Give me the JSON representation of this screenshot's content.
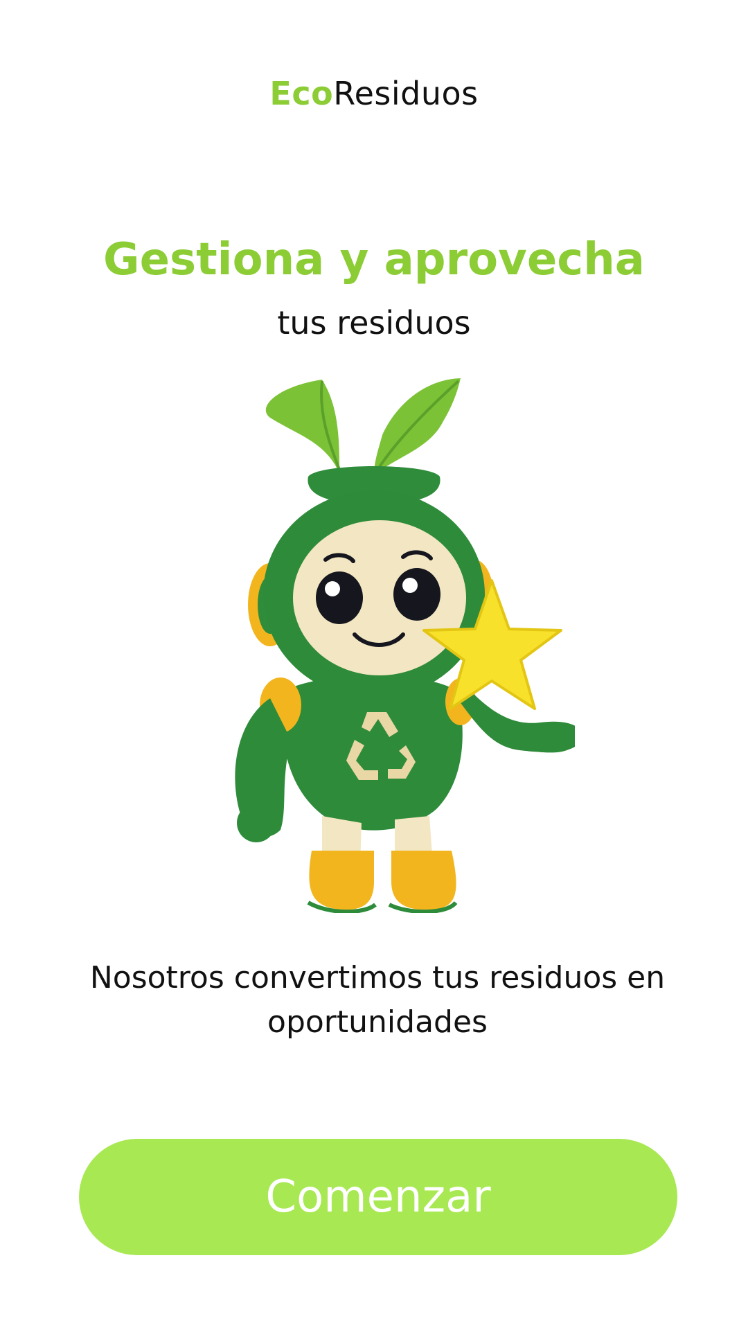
{
  "header": {
    "brand_prefix": "Eco",
    "brand_suffix": "Residuos"
  },
  "hero": {
    "title": "Gestiona y aprovecha",
    "subtitle": "tus residuos",
    "mascot_icon": "recycling-mascot-icon"
  },
  "tagline": "Nosotros convertimos tus residuos en oportunidades",
  "cta": {
    "label": "Comenzar"
  },
  "colors": {
    "accent": "#8ccc35",
    "button": "#a8e852",
    "mascot_green": "#2e8b3a",
    "mascot_yellow": "#f2b51d",
    "star": "#f7e12a"
  }
}
